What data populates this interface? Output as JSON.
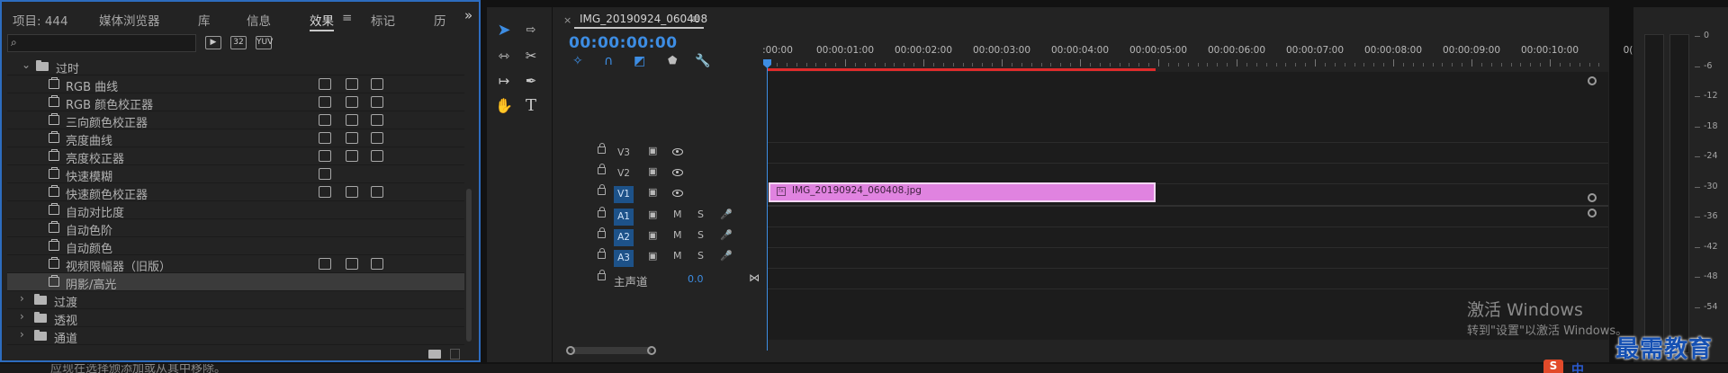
{
  "left_panel": {
    "tabs": [
      "项目: 444",
      "媒体浏览器",
      "库",
      "信息",
      "效果",
      "标记",
      "历"
    ],
    "active_tab": "效果",
    "tab_menu_icon": "≡",
    "overflow_icon": "»",
    "search": {
      "value": "",
      "placeholder": ""
    },
    "header_badges": [
      "▶",
      "32",
      "YUV"
    ],
    "tree": [
      {
        "type": "folder",
        "label": "过时",
        "expanded": true,
        "level": 1
      },
      {
        "type": "effect",
        "label": "RGB 曲线",
        "badges": 3
      },
      {
        "type": "effect",
        "label": "RGB 颜色校正器",
        "badges": 3
      },
      {
        "type": "effect",
        "label": "三向颜色校正器",
        "badges": 3
      },
      {
        "type": "effect",
        "label": "亮度曲线",
        "badges": 3
      },
      {
        "type": "effect",
        "label": "亮度校正器",
        "badges": 3
      },
      {
        "type": "effect",
        "label": "快速模糊",
        "badges": 1
      },
      {
        "type": "effect",
        "label": "快速颜色校正器",
        "badges": 3
      },
      {
        "type": "effect",
        "label": "自动对比度",
        "badges": 0
      },
      {
        "type": "effect",
        "label": "自动色阶",
        "badges": 0
      },
      {
        "type": "effect",
        "label": "自动颜色",
        "badges": 0
      },
      {
        "type": "effect",
        "label": "视频限幅器（旧版）",
        "badges": 3
      },
      {
        "type": "effect",
        "label": "阴影/高光",
        "badges": 0,
        "selected": true
      },
      {
        "type": "folder",
        "label": "过渡",
        "expanded": false,
        "level": 0
      },
      {
        "type": "folder",
        "label": "透视",
        "expanded": false,
        "level": 0
      },
      {
        "type": "folder",
        "label": "通道",
        "expanded": false,
        "level": 0
      }
    ]
  },
  "tools": {
    "items": [
      "selection-tool",
      "track-select-tool",
      "ripple-edit-tool",
      "razor-tool",
      "slip-tool",
      "pen-tool",
      "hand-tool",
      "type-tool"
    ],
    "type_glyph": "T"
  },
  "timeline": {
    "tab_close": "×",
    "title": "IMG_20190924_060408",
    "tab_menu_icon": "≡",
    "timecode": "00:00:00:00",
    "ruler_labels": [
      ":00:00",
      "00:00:01:00",
      "00:00:02:00",
      "00:00:03:00",
      "00:00:04:00",
      "00:00:05:00",
      "00:00:06:00",
      "00:00:07:00",
      "00:00:08:00",
      "00:00:09:00",
      "00:00:10:00",
      "0("
    ],
    "video_tracks": [
      "V3",
      "V2",
      "V1"
    ],
    "audio_tracks": [
      "A1",
      "A2",
      "A3"
    ],
    "mute_label": "M",
    "solo_label": "S",
    "master": {
      "label": "主声道",
      "value": "0.0"
    },
    "clip": {
      "label": "IMG_20190924_060408.jpg",
      "fx_label": "fx"
    }
  },
  "meters": {
    "labels": [
      "0",
      "-6",
      "-12",
      "-18",
      "-24",
      "-30",
      "-36",
      "-42",
      "-48",
      "-54"
    ]
  },
  "watermark": {
    "title": "激活 Windows",
    "subtitle": "转到\"设置\"以激活 Windows。"
  },
  "status": {
    "text": "应现在选择颁添加或从其中移除。"
  },
  "brand": {
    "text": "最需教育"
  },
  "ime": {
    "s_label": "S",
    "zh_label": "中"
  },
  "colors": {
    "accent": "#3d8de3",
    "panel_bg": "#232323",
    "clip": "#e083e0",
    "render_bar": "#e02b2b",
    "selection_border": "#2d6cbf"
  }
}
